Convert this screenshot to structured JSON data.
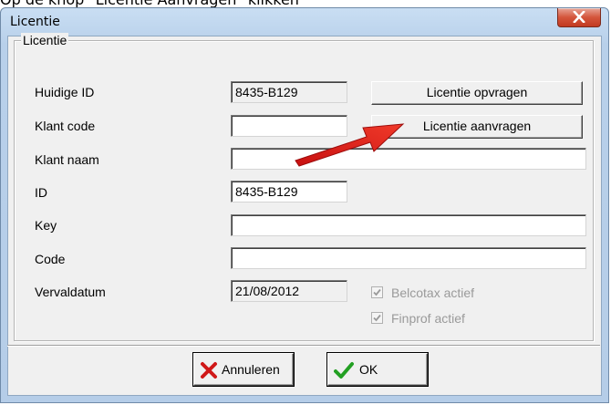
{
  "caption": "Op de knop \"Licentie Aanvragen\" klikken",
  "window": {
    "title": "Licentie"
  },
  "group": {
    "legend": "Licentie"
  },
  "fields": {
    "huidige_id": {
      "label": "Huidige ID",
      "value": "8435-B129"
    },
    "klant_code": {
      "label": "Klant code",
      "value": ""
    },
    "klant_naam": {
      "label": "Klant naam",
      "value": ""
    },
    "id": {
      "label": "ID",
      "value": "8435-B129"
    },
    "key": {
      "label": "Key",
      "value": ""
    },
    "code": {
      "label": "Code",
      "value": ""
    },
    "vervaldatum": {
      "label": "Vervaldatum",
      "value": "21/08/2012"
    }
  },
  "buttons": {
    "opvragen": "Licentie opvragen",
    "aanvragen": "Licentie aanvragen",
    "annuleren": "Annuleren",
    "ok": "OK"
  },
  "checkboxes": [
    {
      "label": "Belcotax actief",
      "checked": true,
      "enabled": false
    },
    {
      "label": "Finprof actief",
      "checked": true,
      "enabled": false
    }
  ],
  "colors": {
    "arrow": "#e01b1b",
    "titlebar": "#b9d1ea",
    "close": "#c8442b"
  },
  "icons": {
    "close": "close-icon",
    "cancel": "red-x-icon",
    "ok": "green-check-icon"
  }
}
